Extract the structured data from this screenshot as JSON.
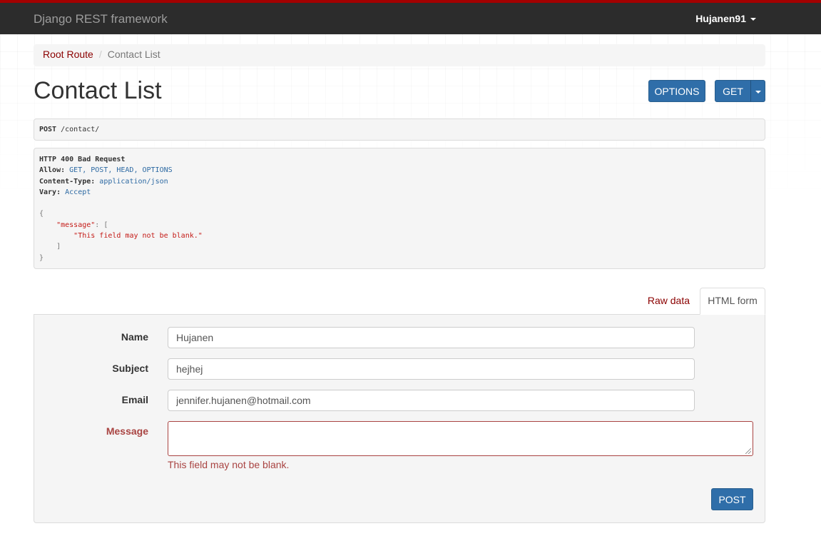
{
  "navbar": {
    "brand": "Django REST framework",
    "user": "Hujanen91"
  },
  "breadcrumb": {
    "items": [
      "Root Route",
      "Contact List"
    ],
    "separator": "/"
  },
  "page": {
    "title": "Contact List"
  },
  "toolbar": {
    "options_label": "OPTIONS",
    "get_label": "GET"
  },
  "request": {
    "method": "POST",
    "path": " /contact/"
  },
  "response": {
    "status": "HTTP 400 Bad Request",
    "headers": [
      {
        "name": "Allow:",
        "value": " GET, POST, HEAD, OPTIONS"
      },
      {
        "name": "Content-Type:",
        "value": " application/json"
      },
      {
        "name": "Vary:",
        "value": " Accept"
      }
    ],
    "body": {
      "open_brace": "{",
      "key": "\"message\"",
      "colon": ": ",
      "open_bracket": "[",
      "error_string": "\"This field may not be blank.\"",
      "close_bracket": "]",
      "close_brace": "}"
    }
  },
  "tabs": {
    "raw": "Raw data",
    "html": "HTML form"
  },
  "form": {
    "fields": [
      {
        "label": "Name",
        "value": "Hujanen"
      },
      {
        "label": "Subject",
        "value": "hejhej"
      },
      {
        "label": "Email",
        "value": "jennifer.hujanen@hotmail.com"
      },
      {
        "label": "Message",
        "value": ""
      }
    ],
    "error_text": "This field may not be blank.",
    "submit_label": "POST"
  },
  "colors": {
    "navbar_bg": "#2c2c2c",
    "navbar_accent": "#a30000",
    "primary_button": "#2f6ea9",
    "link": "#8b0000",
    "error": "#a94442"
  }
}
